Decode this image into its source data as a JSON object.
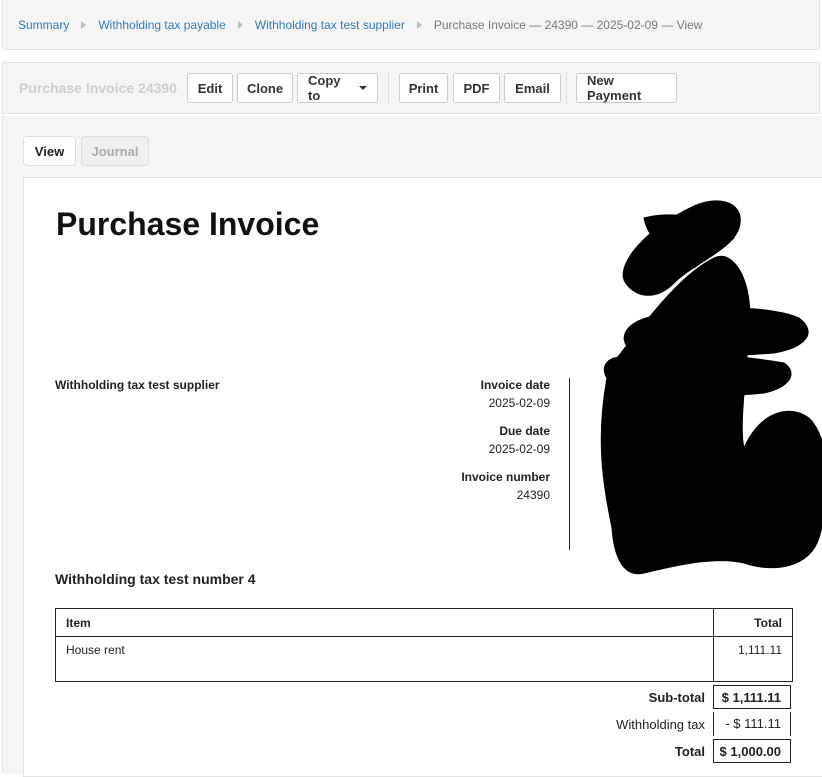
{
  "breadcrumb": {
    "items": [
      "Summary",
      "Withholding tax payable",
      "Withholding tax test supplier"
    ],
    "current": "Purchase Invoice — 24390 — 2025-02-09 — View"
  },
  "toolbar": {
    "doc_title": "Purchase Invoice 24390",
    "edit": "Edit",
    "clone": "Clone",
    "copy_to": "Copy to",
    "print": "Print",
    "pdf": "PDF",
    "email": "Email",
    "new_payment": "New Payment"
  },
  "tabs": {
    "view": "View",
    "journal": "Journal"
  },
  "invoice": {
    "title": "Purchase Invoice",
    "supplier": "Withholding tax test supplier",
    "invoice_date_label": "Invoice date",
    "invoice_date": "2025-02-09",
    "due_date_label": "Due date",
    "due_date": "2025-02-09",
    "invoice_number_label": "Invoice number",
    "invoice_number": "24390",
    "subject": "Withholding tax test number 4",
    "table": {
      "headers": {
        "item": "Item",
        "total": "Total"
      },
      "rows": [
        {
          "item": "House rent",
          "total": "1,111.11"
        }
      ]
    },
    "subtotal_label": "Sub-total",
    "subtotal": "$ 1,111.11",
    "withholding_label": "Withholding tax",
    "withholding": "- $ 111.11",
    "total_label": "Total",
    "total": "$ 1,000.00"
  }
}
